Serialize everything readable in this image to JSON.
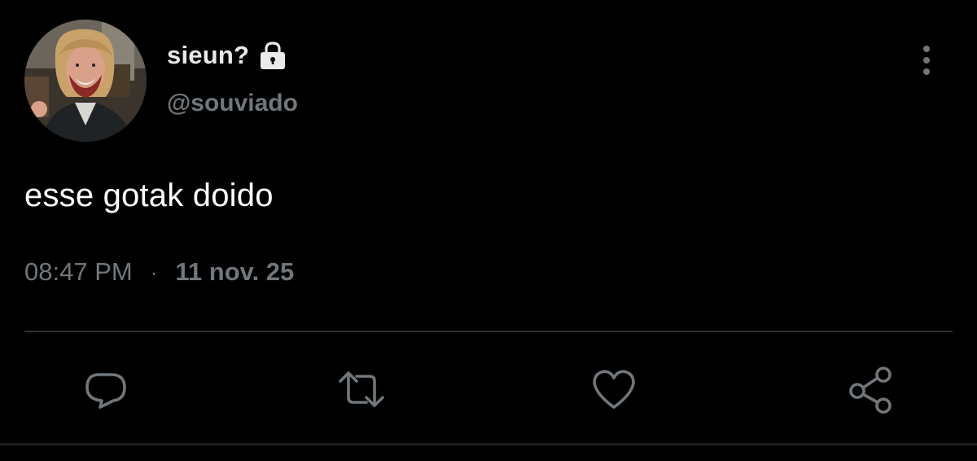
{
  "tweet": {
    "author": {
      "display_name": "sieun?",
      "handle": "@souviado",
      "avatar": "profile-photo",
      "protected_icon": "lock-icon"
    },
    "menu_icon": "more-vertical-icon",
    "text": "esse gotak doido",
    "time": "08:47 PM",
    "separator": "·",
    "date": "11 nov. 25"
  },
  "actions": [
    {
      "name": "reply",
      "icon": "reply-icon"
    },
    {
      "name": "retweet",
      "icon": "retweet-icon"
    },
    {
      "name": "like",
      "icon": "heart-icon"
    },
    {
      "name": "share",
      "icon": "share-icon"
    }
  ],
  "colors": {
    "background": "#000000",
    "primary_text": "#e7e9ea",
    "secondary_text": "#71767b",
    "divider": "#2f3336"
  }
}
